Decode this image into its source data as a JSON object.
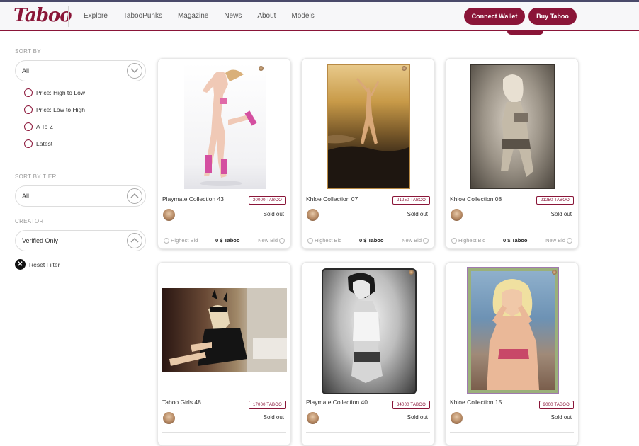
{
  "header": {
    "logo": "Taboo",
    "nav": [
      "Explore",
      "TabooPunks",
      "Magazine",
      "News",
      "About",
      "Models"
    ],
    "connect_wallet": "Connect Wallet",
    "buy_taboo": "Buy Taboo",
    "accent_color": "#8a1538"
  },
  "sidebar": {
    "sort_by_label": "SORT BY",
    "sort_by_value": "All",
    "sort_options": [
      "Price: High to Low",
      "Price: Low to High",
      "A To Z",
      "Latest"
    ],
    "tier_label": "SORT BY TIER",
    "tier_value": "All",
    "creator_label": "CREATOR",
    "creator_value": "Verified Only",
    "reset_label": "Reset Filter"
  },
  "cards": [
    {
      "title": "Playmate Collection 43",
      "price": "20000 TABOO",
      "status": "Sold out",
      "highest_bid_label": "Highest Bid",
      "amount": "0 $ Taboo",
      "new_bid_label": "New Bid"
    },
    {
      "title": "Khloe Collection 07",
      "price": "21250 TABOO",
      "status": "Sold out",
      "highest_bid_label": "Highest Bid",
      "amount": "0 $ Taboo",
      "new_bid_label": "New Bid"
    },
    {
      "title": "Khloe Collection 08",
      "price": "21250 TABOO",
      "status": "Sold out",
      "highest_bid_label": "Highest Bid",
      "amount": "0 $ Taboo",
      "new_bid_label": "New Bid"
    },
    {
      "title": "Taboo Girls 48",
      "price": "17000 TABOO",
      "status": "Sold out"
    },
    {
      "title": "Playmate Collection 40",
      "price": "34000 TABOO",
      "status": "Sold out"
    },
    {
      "title": "Khloe Collection 15",
      "price": "9000 TABOO",
      "status": "Sold out"
    }
  ]
}
